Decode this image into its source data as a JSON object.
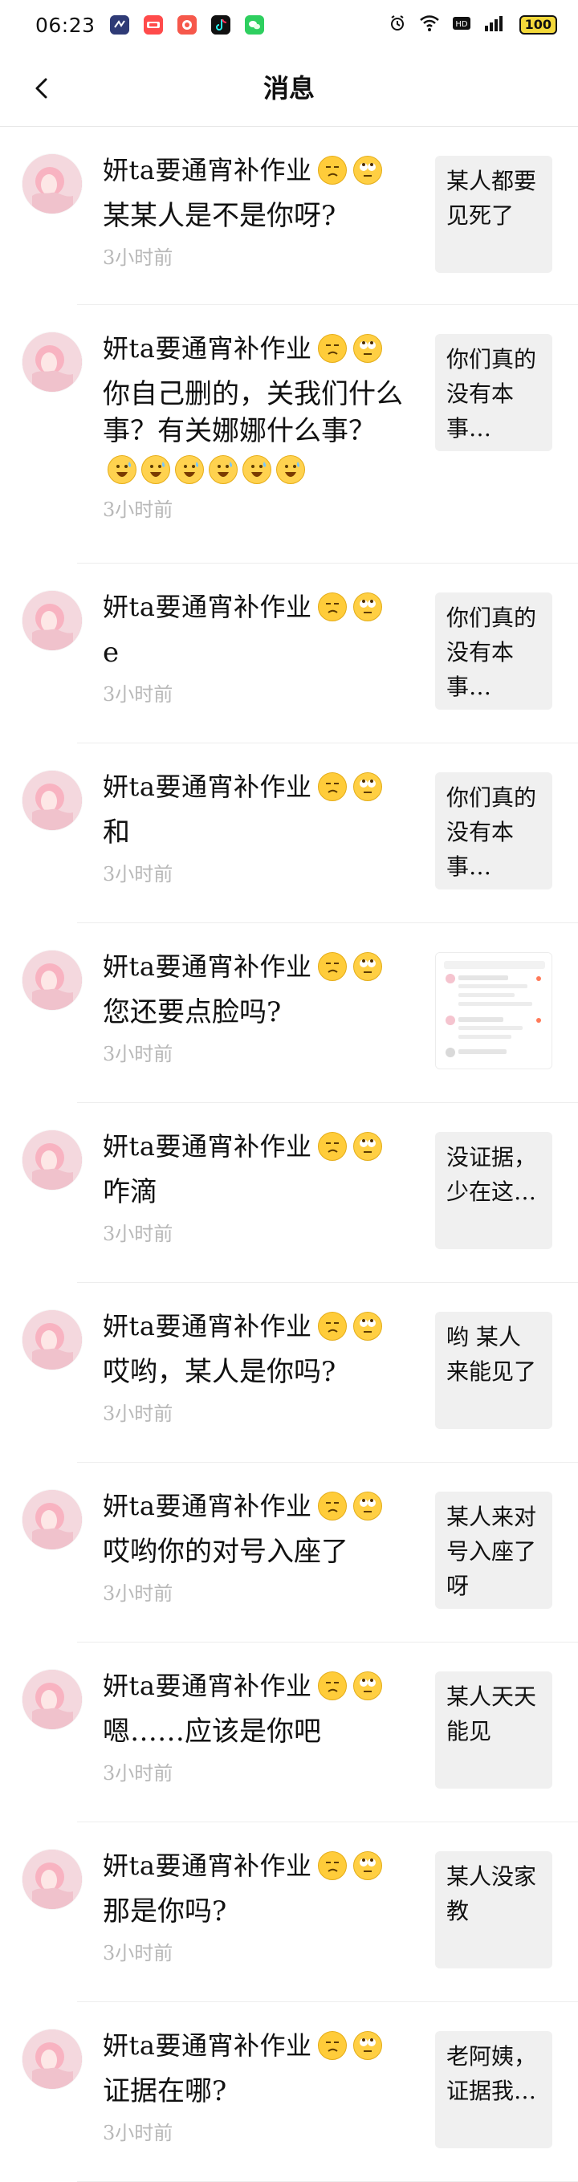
{
  "status_bar": {
    "time": "06:23",
    "icons": [
      "app-icon-1",
      "app-icon-2",
      "app-icon-3",
      "tiktok-icon",
      "wechat-icon"
    ],
    "right_icons": [
      "alarm-icon",
      "wifi-icon",
      "hd-icon",
      "signal-icon",
      "battery-icon"
    ],
    "battery_level": "100"
  },
  "navbar": {
    "back_icon": "back-icon",
    "title": "消息"
  },
  "messages": [
    {
      "sender": "妍ta要通宵补作业",
      "text": "某某人是不是你呀?",
      "time": "3小时前",
      "preview_text": "某人都要见死了"
    },
    {
      "sender": "妍ta要通宵补作业",
      "text": "你自己删的，关我们什么事？有关娜娜什么事？",
      "time": "3小时前",
      "preview_text": "你们真的没有本事…"
    },
    {
      "sender": "妍ta要通宵补作业",
      "text": "e",
      "time": "3小时前",
      "preview_text": "你们真的没有本事…"
    },
    {
      "sender": "妍ta要通宵补作业",
      "text": "和",
      "time": "3小时前",
      "preview_text": "你们真的没有本事…"
    },
    {
      "sender": "妍ta要通宵补作业",
      "text": "您还要点脸吗?",
      "time": "3小时前",
      "preview_type": "image"
    },
    {
      "sender": "妍ta要通宵补作业",
      "text": "咋滴",
      "time": "3小时前",
      "preview_text": "没证据，少在这…"
    },
    {
      "sender": "妍ta要通宵补作业",
      "text": "哎哟，某人是你吗?",
      "time": "3小时前",
      "preview_text": "哟 某人来能见了"
    },
    {
      "sender": "妍ta要通宵补作业",
      "text": "哎哟你的对号入座了",
      "time": "3小时前",
      "preview_text": "某人来对号入座了呀"
    },
    {
      "sender": "妍ta要通宵补作业",
      "text": "嗯……应该是你吧",
      "time": "3小时前",
      "preview_text": "某人天天能见"
    },
    {
      "sender": "妍ta要通宵补作业",
      "text": "那是你吗?",
      "time": "3小时前",
      "preview_text": "某人没家教"
    },
    {
      "sender": "妍ta要通宵补作业",
      "text": "证据在哪?",
      "time": "3小时前",
      "preview_text": "老阿姨，证据我…"
    }
  ],
  "colors": {
    "background": "#ffffff",
    "text": "#111111",
    "secondary_text": "#b8b8b8",
    "preview_bg": "#f0f0f0",
    "divider": "#ededed",
    "emoji_yellow": "#ffcc3a"
  }
}
